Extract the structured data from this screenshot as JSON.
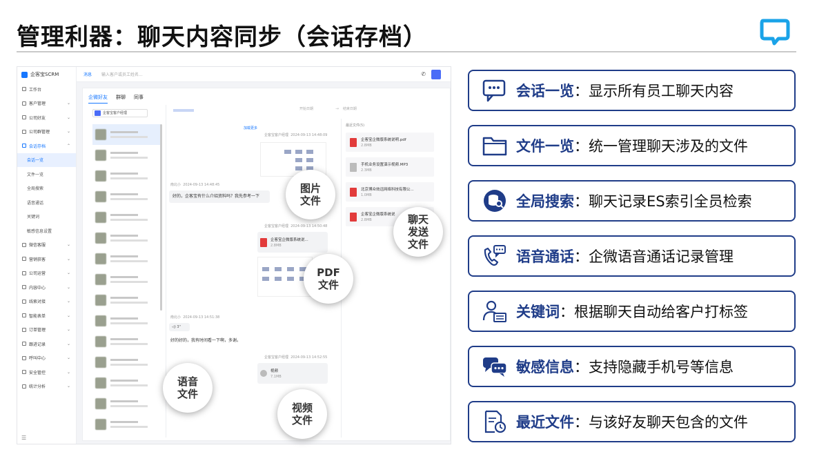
{
  "header": {
    "title": "管理利器：聊天内容同步（会话存档）"
  },
  "app": {
    "brand": "企客宝SCRM",
    "topbar": {
      "tab": "消息",
      "search_placeholder": "输入客户或员工姓名..."
    },
    "sidebar": {
      "items": [
        "工作台",
        "客户管理",
        "公司好友",
        "公司群管理",
        "会话存档",
        "微信客服",
        "营销获客",
        "公司运营",
        "内容中心",
        "线索对接",
        "智能表单",
        "订单管理",
        "跟进记录",
        "呼叫中心",
        "安全管控",
        "统计分析"
      ],
      "subitems": [
        "会话一览",
        "文件一览",
        "全局搜索",
        "语音通话",
        "关键词",
        "敏感信息设置"
      ]
    },
    "tabs": [
      "企微好友",
      "群聊",
      "同事"
    ],
    "contact_filter": "企客宝客户经理",
    "chat": {
      "date_start": "开始日期",
      "date_end": "结束日期",
      "load_more": "加载更多",
      "sender": "企客宝客户经理",
      "customer": "南北小",
      "msg1_time": "2024-09-13 14:48:09",
      "msg2_time": "2024-09-13 14:48:45",
      "msg2_text": "好的，企客宝有什么介绍资料吗？我先参考一下",
      "msg3_time": "2024-09-13 14:50:48",
      "msg3_file": "企客宝企微版系统说...",
      "msg3_size": "2.8MB",
      "msg4_time": "2024-09-13 14:51:38",
      "voice_label": "3\"",
      "msg5_text": "好的好的，我有时间看一下啊，多谢。",
      "msg6_time": "2024-09-13 14:52:55",
      "video_name": "视频",
      "video_size": "7.1MB"
    },
    "recent": {
      "head": "最近文件(5)",
      "files": [
        {
          "name": "企客宝企微版系统说明.pdf",
          "size": "2.8MB"
        },
        {
          "name": "手机业务设置演示视频.MP3",
          "size": "2.3MB"
        },
        {
          "name": "北京博众效远网络科技有限公...",
          "size": "1.0MB"
        },
        {
          "name": "企客宝企微版系统说",
          "size": "2.8MB"
        }
      ]
    }
  },
  "callouts": {
    "image_file": [
      "图片",
      "文件"
    ],
    "pdf_file": [
      "PDF",
      "文件"
    ],
    "chat_send_file": [
      "聊天",
      "发送",
      "文件"
    ],
    "voice_file": [
      "语音",
      "文件"
    ],
    "video_file": [
      "视频",
      "文件"
    ]
  },
  "features": [
    {
      "key": "会话一览",
      "sep": "：",
      "desc": "显示所有员工聊天内容",
      "icon": "chat-dots-icon"
    },
    {
      "key": "文件一览",
      "sep": "：",
      "desc": "统一管理聊天涉及的文件",
      "icon": "folder-icon"
    },
    {
      "key": "全局搜索",
      "sep": "：",
      "desc": "聊天记录ES索引全员检索",
      "icon": "database-search-icon"
    },
    {
      "key": "语音通话",
      "sep": "：",
      "desc": "企微语音通话记录管理",
      "icon": "phone-chat-icon"
    },
    {
      "key": "关键词",
      "sep": "：",
      "desc": "根据聊天自动给客户打标签",
      "icon": "user-tag-icon"
    },
    {
      "key": "敏感信息",
      "sep": "：",
      "desc": "支持隐藏手机号等信息",
      "icon": "chat-bubbles-icon"
    },
    {
      "key": "最近文件",
      "sep": "：",
      "desc": "与该好友聊天包含的文件",
      "icon": "file-clock-icon"
    }
  ],
  "colors": {
    "accent": "#1f3c88",
    "brand": "#1677ff",
    "logo": "#1aa3e8"
  }
}
